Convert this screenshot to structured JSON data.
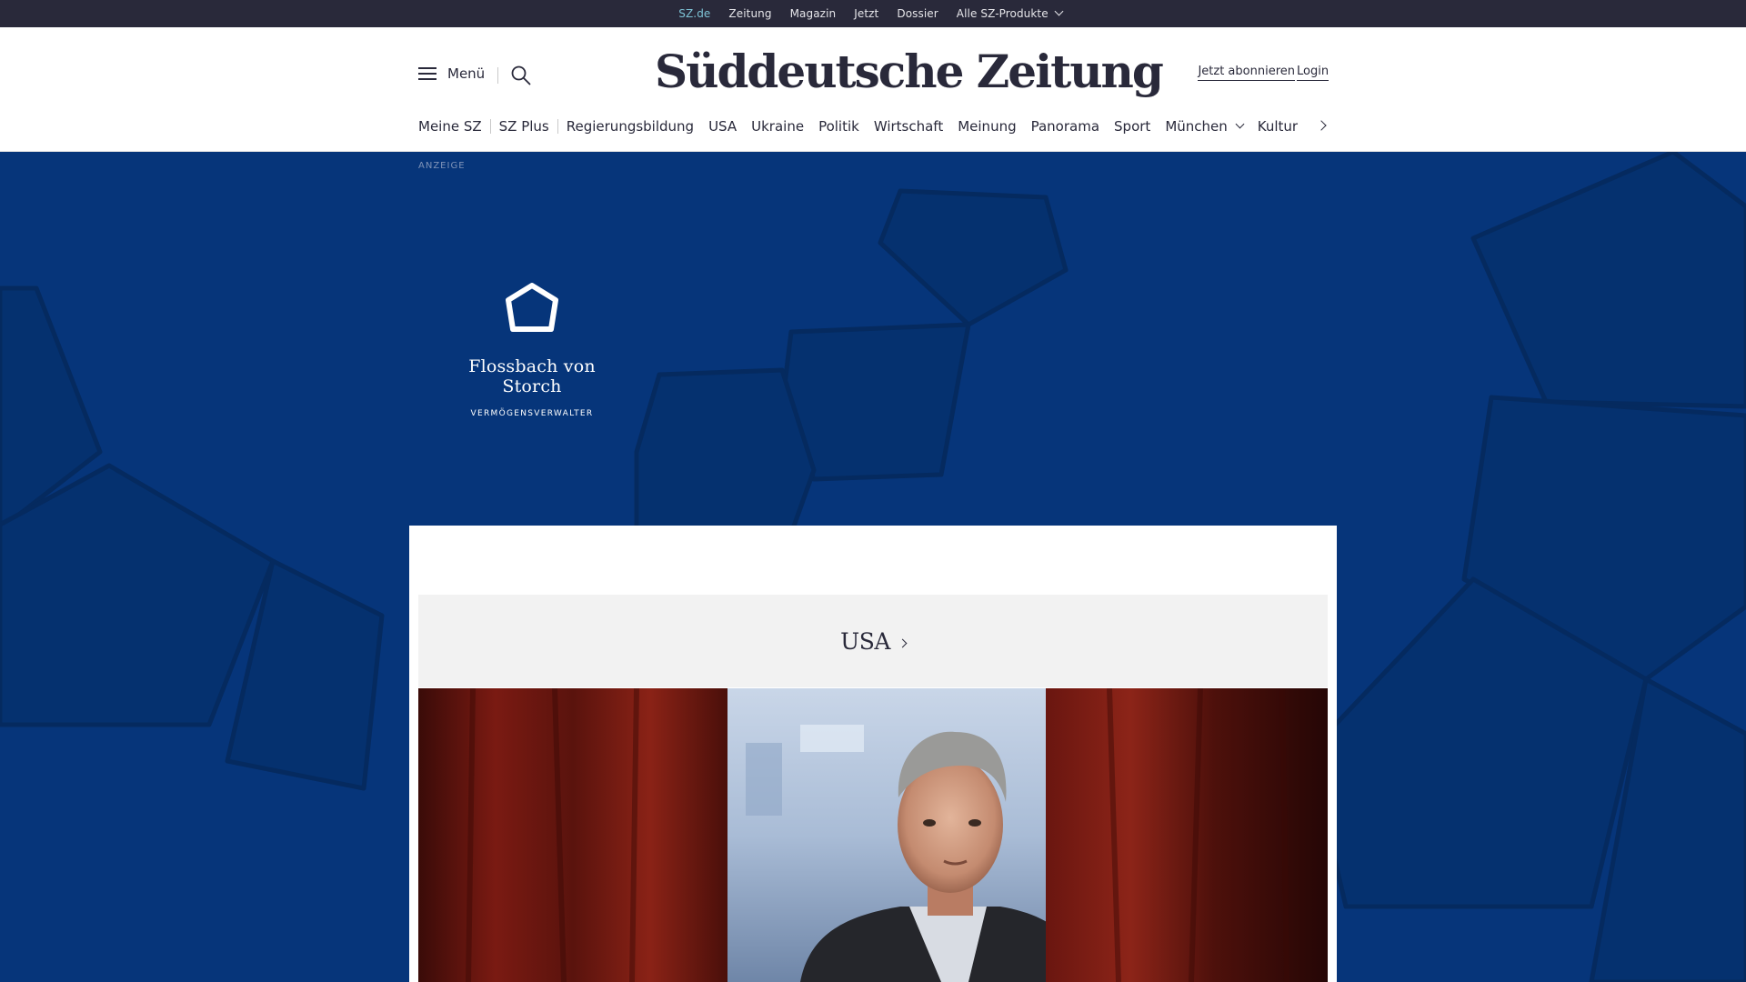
{
  "topbar": {
    "items": [
      "SZ.de",
      "Zeitung",
      "Magazin",
      "Jetzt",
      "Dossier",
      "Alle SZ-Produkte"
    ]
  },
  "header": {
    "menu_label": "Menü",
    "logo_text": "Süddeutsche Zeitung",
    "subscribe_label": "Jetzt abonnieren",
    "login_label": "Login"
  },
  "nav": {
    "items": [
      "Meine SZ",
      "SZ Plus",
      "Regierungsbildung",
      "USA",
      "Ukraine",
      "Politik",
      "Wirtschaft",
      "Meinung",
      "Panorama",
      "Sport",
      "München",
      "Kultur"
    ]
  },
  "ad": {
    "label": "ANZEIGE",
    "brand_name": "Flossbach von Storch",
    "brand_sub": "VERMÖGENSVERWALTER"
  },
  "section": {
    "title": "USA"
  },
  "colors": {
    "topbar_bg": "#29293a",
    "active_link": "#7ec3d6",
    "ad_bg": "#06357a",
    "section_bg": "#f2f2f2"
  }
}
